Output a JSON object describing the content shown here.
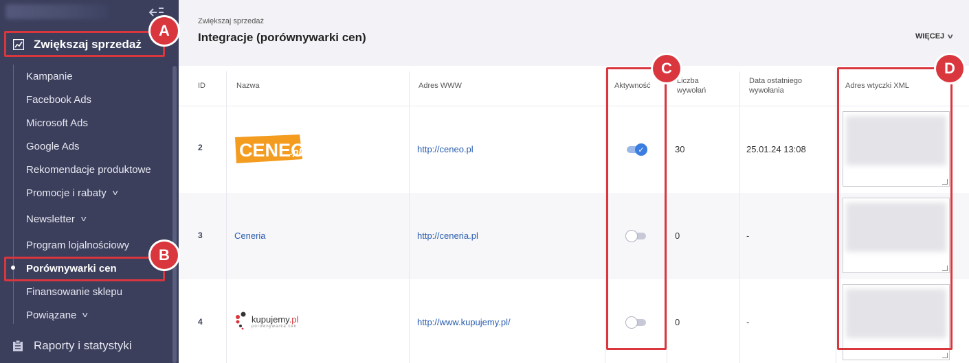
{
  "sidebar": {
    "section_title": "Zwiększaj sprzedaż",
    "items": [
      {
        "label": "Kampanie"
      },
      {
        "label": "Facebook Ads"
      },
      {
        "label": "Microsoft Ads"
      },
      {
        "label": "Google Ads"
      },
      {
        "label": "Rekomendacje produktowe"
      },
      {
        "label": "Promocje i rabaty"
      },
      {
        "label": "Newsletter"
      },
      {
        "label": "Program lojalnościowy"
      },
      {
        "label": "Porównywarki cen"
      },
      {
        "label": "Finansowanie sklepu"
      },
      {
        "label": "Powiązane"
      }
    ],
    "reports_label": "Raporty i statystyki"
  },
  "header": {
    "breadcrumb": "Zwiększaj sprzedaż",
    "title": "Integracje (porównywarki cen)",
    "more_label": "WIĘCEJ"
  },
  "table": {
    "columns": {
      "id": "ID",
      "name": "Nazwa",
      "url": "Adres WWW",
      "activity": "Aktywność",
      "calls_1": "Liczba",
      "calls_2": "wywołań",
      "last_1": "Data ostatniego",
      "last_2": "wywołania",
      "xml": "Adres wtyczki XML"
    },
    "rows": [
      {
        "id": "2",
        "name": "CENEO.pl",
        "url": "http://ceneo.pl",
        "active": true,
        "calls": "30",
        "last": "25.01.24 13:08"
      },
      {
        "id": "3",
        "name": "Ceneria",
        "url": "http://ceneria.pl",
        "active": false,
        "calls": "0",
        "last": "-"
      },
      {
        "id": "4",
        "name": "kupujemy.pl",
        "url": "http://www.kupujemy.pl/",
        "active": false,
        "calls": "0",
        "last": "-"
      }
    ]
  },
  "logos": {
    "ceneo_main": "CENEO",
    "ceneo_suffix": ".pl",
    "kupujemy_main": "kupujemy",
    "kupujemy_suffix": ".pl",
    "kupujemy_sub": "porownywarka cen"
  },
  "callouts": {
    "a": "A",
    "b": "B",
    "c": "C",
    "d": "D"
  },
  "colors": {
    "sidebar_bg": "#3b3f5c",
    "accent_red": "#d9363e",
    "link_blue": "#2a5db0",
    "toggle_on": "#3b7de0"
  }
}
